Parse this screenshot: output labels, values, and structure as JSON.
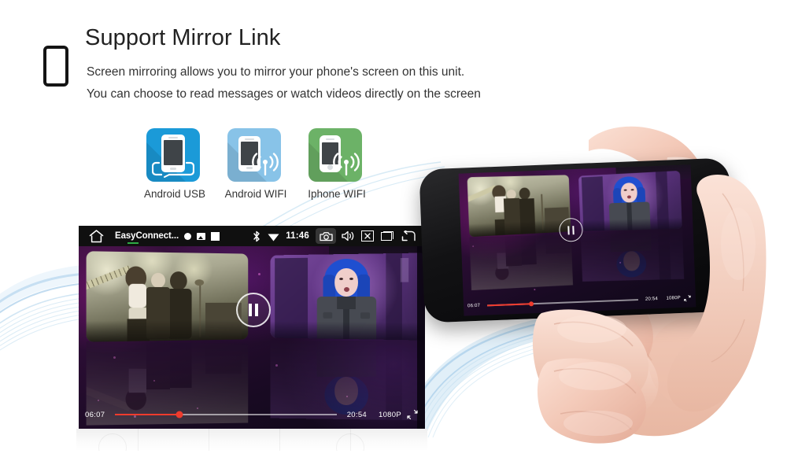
{
  "header": {
    "icon": "smartphone-outline-icon",
    "title": "Support Mirror Link",
    "line1": "Screen mirroring allows you to mirror your phone's screen on this unit.",
    "line2": "You can choose to read messages or watch videos directly on the screen"
  },
  "connection_modes": [
    {
      "label": "Android USB",
      "icon": "phone-usb-cable-icon",
      "color": "#1b9ad8"
    },
    {
      "label": "Android WIFI",
      "icon": "phone-wifi-icon",
      "color": "#88c3e8"
    },
    {
      "label": "Iphone WIFI",
      "icon": "iphone-wifi-icon",
      "color": "#6cb267"
    }
  ],
  "head_unit": {
    "status_bar": {
      "home_icon": "home-icon",
      "app_name": "EasyConnect...",
      "dot_icon": "record-dot-icon",
      "image_icon": "photo-icon",
      "square_icon": "stop-square-icon",
      "bluetooth_icon": "bluetooth-icon",
      "wifi_icon": "wifi-icon",
      "clock": "11:46",
      "camera_icon": "camera-icon",
      "volume_icon": "volume-icon",
      "close_icon": "close-box-icon",
      "windows_icon": "multi-window-icon",
      "back_icon": "back-arrow-icon"
    },
    "player": {
      "pause_icon": "pause-icon",
      "current_time": "06:07",
      "duration": "20:54",
      "resolution": "1080P",
      "shrink_icon": "shrink-screen-icon",
      "progress_percent": 29
    }
  },
  "phone": {
    "player": {
      "pause_icon": "pause-icon",
      "current_time": "06:07",
      "duration": "20:54",
      "resolution": "1080P",
      "shrink_icon": "shrink-screen-icon",
      "progress_percent": 29
    }
  },
  "colors": {
    "accent_red": "#ef3b2d",
    "status_bar_bg": "#101010",
    "wave_blue": "#7fb8e0",
    "text_dark": "#222222"
  }
}
